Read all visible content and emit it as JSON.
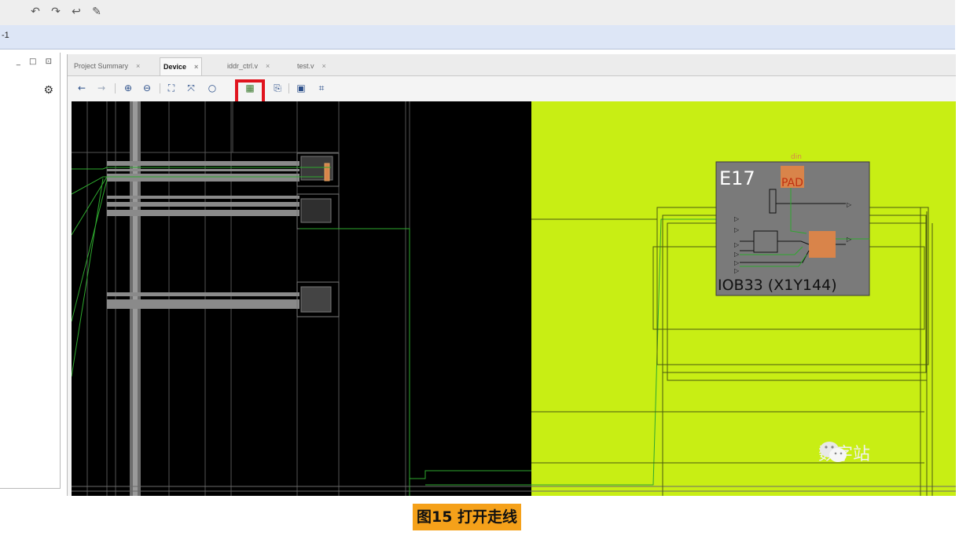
{
  "top_toolbar": {
    "icons": [
      "undo-icon",
      "redo-icon",
      "back-icon",
      "pin-icon"
    ]
  },
  "subbar": {
    "text": "-1"
  },
  "left_panel": {
    "window_controls": "_ □ ⊡",
    "settings_icon": "gear-icon"
  },
  "tabs": [
    {
      "label": "Project Summary",
      "active": false
    },
    {
      "label": "Device",
      "active": true
    },
    {
      "label": "iddr_ctrl.v",
      "active": false
    },
    {
      "label": "test.v",
      "active": false
    }
  ],
  "view_toolbar": {
    "buttons": [
      "back-arrow-icon",
      "forward-arrow-icon",
      "zoom-in-icon",
      "zoom-out-icon",
      "fit-view-icon",
      "zoom-fit-selection-icon",
      "refresh-icon",
      "routing-resources-icon",
      "net-icon",
      "select-area-icon",
      "mark-icon"
    ],
    "highlighted_button": "routing-resources-icon"
  },
  "device_view": {
    "site_name": "E17",
    "pad_label": "PAD",
    "pin_label": "din",
    "tile_label": "IOB33 (X1Y144)",
    "colors": {
      "background": "#000000",
      "highlight_region": "#c8ee14",
      "tile_fill": "#7a7a7a",
      "pad_fill": "#d9844a",
      "route_green": "#2ea82e"
    }
  },
  "watermark": {
    "text": "数字站"
  },
  "caption": {
    "text": "图15 打开走线"
  }
}
